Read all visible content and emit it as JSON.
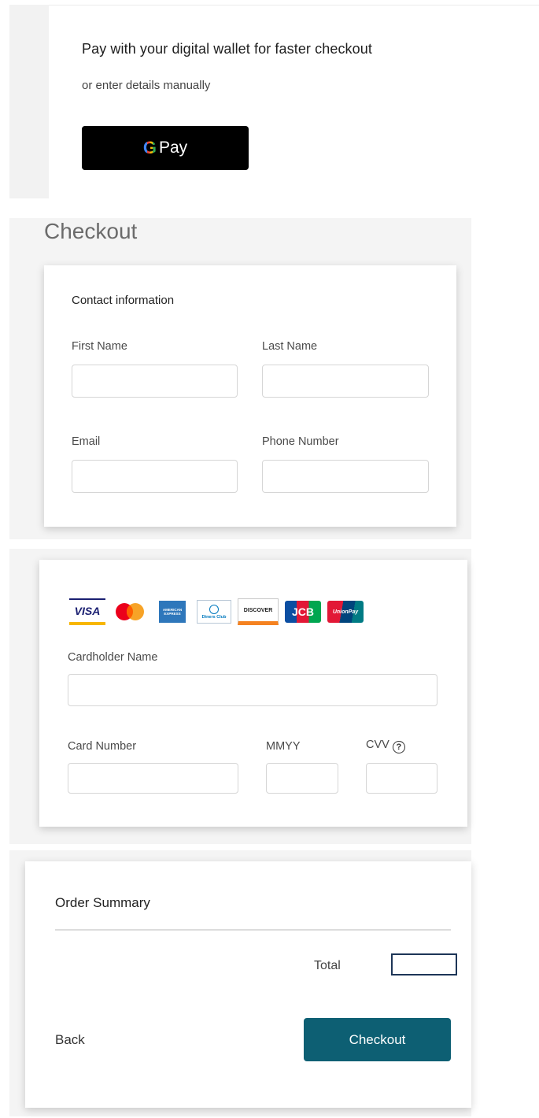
{
  "wallet": {
    "heading": "Pay with your digital wallet for faster checkout",
    "subheading": "or enter details manually",
    "gpay": {
      "g_letter": "G",
      "label": "Pay"
    }
  },
  "checkout": {
    "title": "Checkout",
    "contact": {
      "heading": "Contact information",
      "first_name_label": "First Name",
      "last_name_label": "Last Name",
      "email_label": "Email",
      "phone_label": "Phone Number"
    }
  },
  "payment": {
    "logos": [
      {
        "name": "visa-logo",
        "text": "VISA",
        "color": "#1a1f71"
      },
      {
        "name": "mastercard-logo",
        "text": "",
        "color": "#eb001b"
      },
      {
        "name": "amex-logo",
        "text": "AMERICAN EXPRESS",
        "color": "#2e77bb"
      },
      {
        "name": "diners-club-logo",
        "text": "Diners Club",
        "color": "#0079be"
      },
      {
        "name": "discover-logo",
        "text": "DISCOVER",
        "color": "#f58220"
      },
      {
        "name": "jcb-logo",
        "text": "JCB",
        "color": "#0b4ea2"
      },
      {
        "name": "unionpay-logo",
        "text": "UnionPay",
        "color": "#e21836"
      }
    ],
    "cardholder_label": "Cardholder Name",
    "card_number_label": "Card Number",
    "expiry_label": "MMYY",
    "cvv_label": "CVV",
    "cvv_help_icon": "question-circle-icon"
  },
  "summary": {
    "heading": "Order Summary",
    "total_label": "Total",
    "total_value": "",
    "back_label": "Back",
    "checkout_label": "Checkout"
  },
  "colors": {
    "checkout_button": "#0d5f73",
    "total_box_border": "#1d3557",
    "gpay_button": "#000000"
  }
}
